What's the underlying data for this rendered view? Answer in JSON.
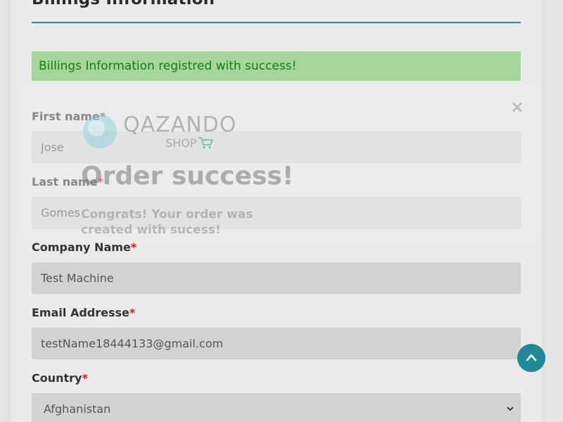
{
  "billing": {
    "heading": "Billings Information",
    "alert": "Billings Information registred with success!"
  },
  "form": {
    "first_name": {
      "label": "First name",
      "required": "*",
      "value": "Jose"
    },
    "last_name": {
      "label": "Last name",
      "required": "*",
      "value": "Gomes"
    },
    "company": {
      "label": "Company Name",
      "required": "*",
      "value": "Test Machine"
    },
    "email": {
      "label": "Email Addresse",
      "required": "*",
      "value": "testName18444133@gmail.com"
    },
    "country": {
      "label": "Country",
      "required": "*",
      "selected": "Afghanistan"
    }
  },
  "modal": {
    "logo_text": "QAZANDO",
    "logo_sub": "SHOP",
    "title": "Order success!",
    "message": "Congrats! Your order was created with sucess!",
    "close": "×"
  },
  "colors": {
    "accent": "#1d8a96",
    "alert_bg": "#a5d79a",
    "alert_text": "#177a17",
    "required": "#cf1b1b"
  },
  "icons": {
    "scroll_top": "chevron-up-icon",
    "cart": "cart-icon",
    "select": "chevron-down-icon"
  }
}
